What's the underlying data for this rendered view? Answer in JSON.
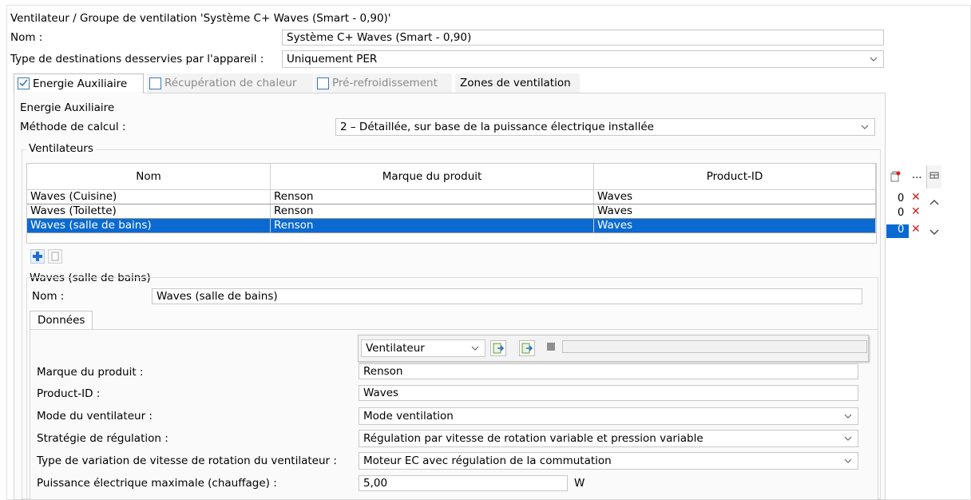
{
  "window": {
    "title": "Ventilateur / Groupe de ventilation 'Système C+ Waves (Smart - 0,90)'"
  },
  "header": {
    "name_label": "Nom :",
    "name_value": "Système C+ Waves (Smart - 0,90)",
    "dest_label": "Type de destinations desservies par l'appareil :",
    "dest_value": "Uniquement PER"
  },
  "tabs": [
    {
      "label": "Energie Auxiliaire",
      "checked": true
    },
    {
      "label": "Récupération de chaleur",
      "checked": false
    },
    {
      "label": "Pré-refroidissement",
      "checked": false
    },
    {
      "label": "Zones de ventilation"
    }
  ],
  "energy": {
    "section_title": "Energie Auxiliaire",
    "method_label": "Méthode de calcul :",
    "method_value": "2 – Détaillée, sur base de la puissance électrique installée",
    "fans_title": "Ventilateurs"
  },
  "fans_table": {
    "columns": [
      "Nom",
      "Marque du produit",
      "Product-ID"
    ],
    "extra_col": "...",
    "rows": [
      {
        "name": "Waves (Cuisine)",
        "brand": "Renson",
        "pid": "Waves",
        "count": "0",
        "selected": false
      },
      {
        "name": "Waves (Toilette)",
        "brand": "Renson",
        "pid": "Waves",
        "count": "0",
        "selected": false
      },
      {
        "name": "Waves (salle de bains)",
        "brand": "Renson",
        "pid": "Waves",
        "count": "0",
        "selected": true
      }
    ]
  },
  "detail": {
    "title": "Waves (salle de bains)",
    "name_label": "Nom :",
    "name_value": "Waves (salle de bains)",
    "tab_label": "Données",
    "type_select": "Ventilateur",
    "fields": {
      "brand_label": "Marque du produit :",
      "brand_value": "Renson",
      "pid_label": "Product-ID :",
      "pid_value": "Waves",
      "mode_label": "Mode du ventilateur :",
      "mode_value": "Mode ventilation",
      "strategy_label": "Stratégie de régulation :",
      "strategy_value": "Régulation par vitesse de rotation variable et pression variable",
      "speed_label": "Type de variation de vitesse de rotation du ventilateur :",
      "speed_value": "Moteur EC avec régulation de la commutation",
      "power_label": "Puissance électrique maximale (chauffage) :",
      "power_value": "5,00",
      "power_unit": "W"
    }
  },
  "colors": {
    "selection": "#0a6ad2",
    "checkbox_border": "#3b78b8",
    "delete_red": "#d21f1f",
    "add_blue": "#1f6fd1"
  }
}
